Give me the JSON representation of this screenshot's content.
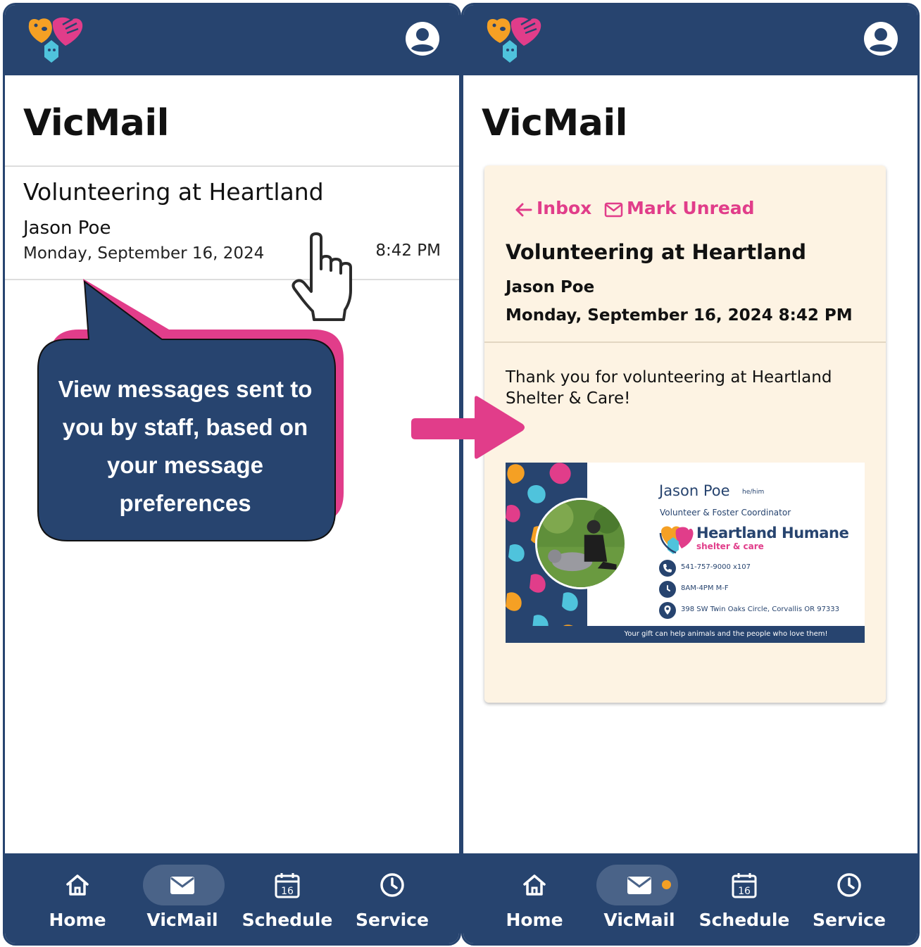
{
  "left_screen": {
    "page_title": "VicMail",
    "message": {
      "subject": "Volunteering at Heartland",
      "sender": "Jason Poe",
      "date": "Monday, September 16, 2024",
      "time": "8:42 PM"
    }
  },
  "right_screen": {
    "page_title": "VicMail",
    "actions": {
      "back": "Inbox",
      "mark_unread": "Mark Unread"
    },
    "message": {
      "subject": "Volunteering at Heartland",
      "sender": "Jason Poe",
      "datetime": "Monday, September 16, 2024 8:42 PM",
      "body": "Thank you for volunteering at Heartland Shelter & Care!"
    },
    "signature": {
      "name": "Jason Poe",
      "pronouns": "he/him",
      "role": "Volunteer & Foster Coordinator",
      "org": "Heartland Humane",
      "org_sub": "shelter & care",
      "phone": "541-757-9000 x107",
      "hours": "8AM-4PM M-F",
      "address": "398 SW Twin Oaks Circle, Corvallis OR 97333",
      "footer": "Your gift can help animals and the people who love them!"
    }
  },
  "nav": {
    "items": [
      {
        "label": "Home",
        "icon": "home-icon"
      },
      {
        "label": "VicMail",
        "icon": "mail-icon"
      },
      {
        "label": "Schedule",
        "icon": "calendar-icon"
      },
      {
        "label": "Service",
        "icon": "clock-icon"
      }
    ],
    "calendar_day": "16",
    "active_index": 1
  },
  "callout": {
    "text": "View messages sent to you by staff, based on your message preferences"
  },
  "colors": {
    "primary": "#27446f",
    "accent_pink": "#e13d8a",
    "accent_orange": "#f5a024",
    "accent_teal": "#4fc3dc",
    "card_bg": "#fdf3e3"
  }
}
